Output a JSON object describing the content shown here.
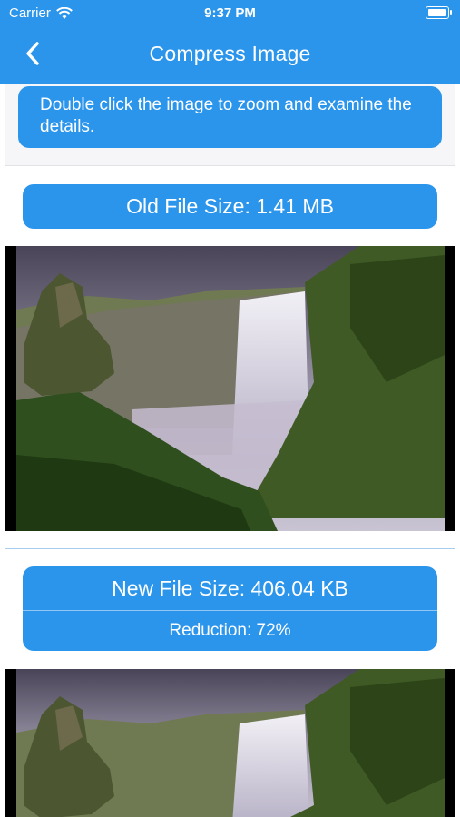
{
  "status_bar": {
    "carrier": "Carrier",
    "time": "9:37 PM"
  },
  "nav": {
    "title": "Compress Image"
  },
  "info": {
    "text": "Double click the image to zoom and examine the details."
  },
  "old_image": {
    "size_label": "Old File Size: 1.41 MB"
  },
  "new_image": {
    "size_label": "New File Size: 406.04 KB",
    "reduction_label": "Reduction: 72%"
  },
  "colors": {
    "accent": "#2b95ec",
    "background": "#ffffff"
  }
}
